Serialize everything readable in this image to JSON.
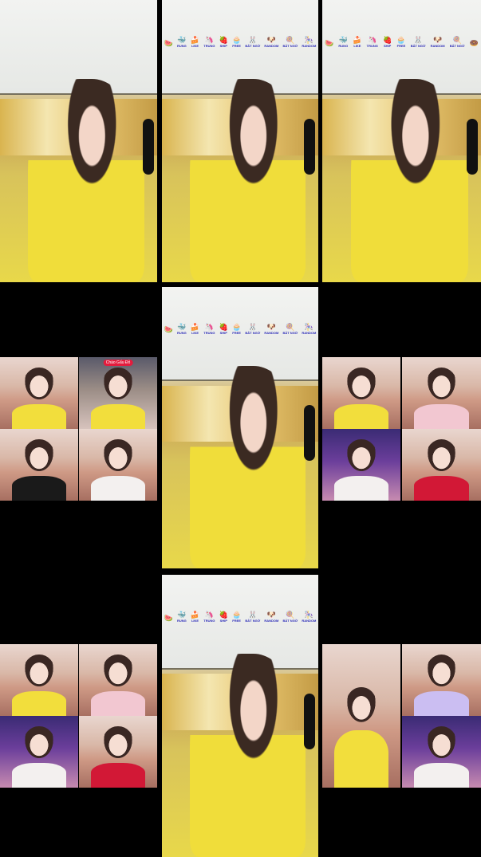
{
  "stickers": [
    {
      "glyph": "🍉",
      "label": ""
    },
    {
      "glyph": "🐳",
      "label": "RUNG"
    },
    {
      "glyph": "🍰",
      "label": "LIKE"
    },
    {
      "glyph": "🦄",
      "label": "TRUNG"
    },
    {
      "glyph": "🍓",
      "label": "SHIP"
    },
    {
      "glyph": "🧁",
      "label": "FREE"
    },
    {
      "glyph": "🐰",
      "label": "BẤT NGỜ"
    },
    {
      "glyph": "🐶",
      "label": "RANDOM"
    },
    {
      "glyph": "🍭",
      "label": "BẤT NGỜ"
    },
    {
      "glyph": "🎠",
      "label": "RANDOM"
    },
    {
      "glyph": "🍩",
      "label": ""
    }
  ],
  "grid_badge": "Chào Gấu Đỏ",
  "icons": {
    "sticker": "sticker-icon"
  }
}
